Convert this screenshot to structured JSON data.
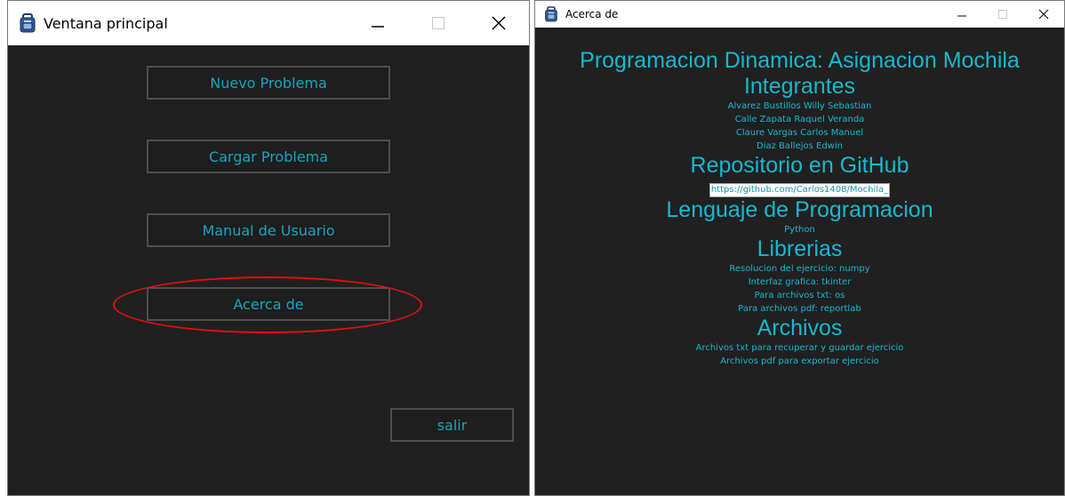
{
  "main_window": {
    "title": "Ventana principal",
    "buttons": {
      "nuevo": "Nuevo Problema",
      "cargar": "Cargar Problema",
      "manual": "Manual de Usuario",
      "acerca": "Acerca de",
      "salir": "salir"
    }
  },
  "about_window": {
    "title": "Acerca de",
    "heading": "Programacion Dinamica: Asignacion Mochila",
    "sections": {
      "integrantes": {
        "heading": "Integrantes",
        "items": [
          "Alvarez Bustillos Willy Sebastian",
          "Calle Zapata Raquel Veranda",
          "Claure Vargas Carlos Manuel",
          "Diaz Ballejos Edwin"
        ]
      },
      "repositorio": {
        "heading": "Repositorio en GitHub",
        "link": "https://github.com/Carlos1408/Mochila_"
      },
      "lenguaje": {
        "heading": "Lenguaje de Programacion",
        "items": [
          "Python"
        ]
      },
      "librerias": {
        "heading": "Librerias",
        "items": [
          "Resolucion del ejercicio: numpy",
          "Interfaz grafica: tkinter",
          "Para archivos txt: os",
          "Para archivos pdf: reportlab"
        ]
      },
      "archivos": {
        "heading": "Archivos",
        "items": [
          "Archivos txt para recuperar y guardar ejercicio",
          "Archivos pdf para exportar ejercicio"
        ]
      }
    }
  },
  "colors": {
    "background": "#202020",
    "text_accent": "#16b8cf",
    "annotation": "#e01010"
  },
  "icons": [
    "backpack-icon",
    "minimize-icon",
    "maximize-icon",
    "close-icon"
  ]
}
